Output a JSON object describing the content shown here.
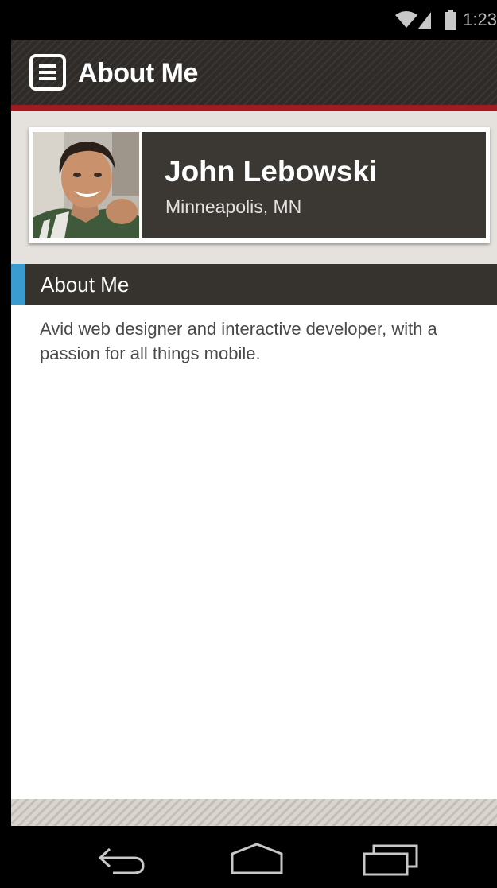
{
  "status_bar": {
    "time": "1:23",
    "icons": [
      "wifi-icon",
      "signal-icon",
      "battery-icon"
    ]
  },
  "action_bar": {
    "title": "About Me",
    "menu_icon": "menu-icon"
  },
  "profile": {
    "name": "John Lebowski",
    "location": "Minneapolis, MN",
    "avatar": "profile-photo"
  },
  "section": {
    "title": "About Me",
    "body": "Avid web designer and interactive developer, with a passion for all things mobile."
  },
  "nav_bar": {
    "icons": [
      "back-icon",
      "home-icon",
      "recent-apps-icon"
    ]
  },
  "colors": {
    "action_bar": "#2e2b28",
    "accent_red": "#9e1b22",
    "accent_blue": "#3a9bd1",
    "panel_dark": "#3b3834",
    "profile_bg": "#e5e2dd"
  }
}
